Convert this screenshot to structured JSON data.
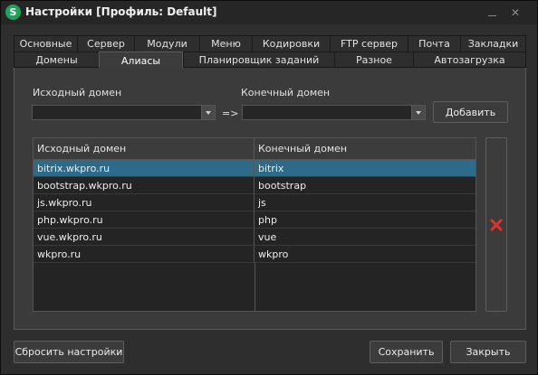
{
  "window": {
    "title": "Настройки [Профиль: Default]",
    "app_icon_letter": "S"
  },
  "tabs_row1": [
    "Основные",
    "Сервер",
    "Модули",
    "Меню",
    "Кодировки",
    "FTP сервер",
    "Почта",
    "Закладки"
  ],
  "tabs_row2": [
    "Домены",
    "Алиасы",
    "Планировщик заданий",
    "Разное",
    "Автозагрузка"
  ],
  "active_tab": "Алиасы",
  "form": {
    "source_label": "Исходный домен",
    "target_label": "Конечный домен",
    "source_value": "",
    "target_value": "",
    "arrow": "=>",
    "add_button": "Добавить"
  },
  "table": {
    "columns": [
      "Исходный домен",
      "Конечный домен"
    ],
    "rows": [
      [
        "bitrix.wkpro.ru",
        "bitrix"
      ],
      [
        "bootstrap.wkpro.ru",
        "bootstrap"
      ],
      [
        "js.wkpro.ru",
        "js"
      ],
      [
        "php.wkpro.ru",
        "php"
      ],
      [
        "vue.wkpro.ru",
        "vue"
      ],
      [
        "wkpro.ru",
        "wkpro"
      ]
    ],
    "selected_row": 0,
    "delete_icon_color": "#e0342a"
  },
  "footer": {
    "reset_button": "Сбросить настройки",
    "save_button": "Сохранить",
    "close_button": "Закрыть"
  },
  "colors": {
    "selection": "#2d6b88",
    "app_icon": "#1fa35a"
  }
}
